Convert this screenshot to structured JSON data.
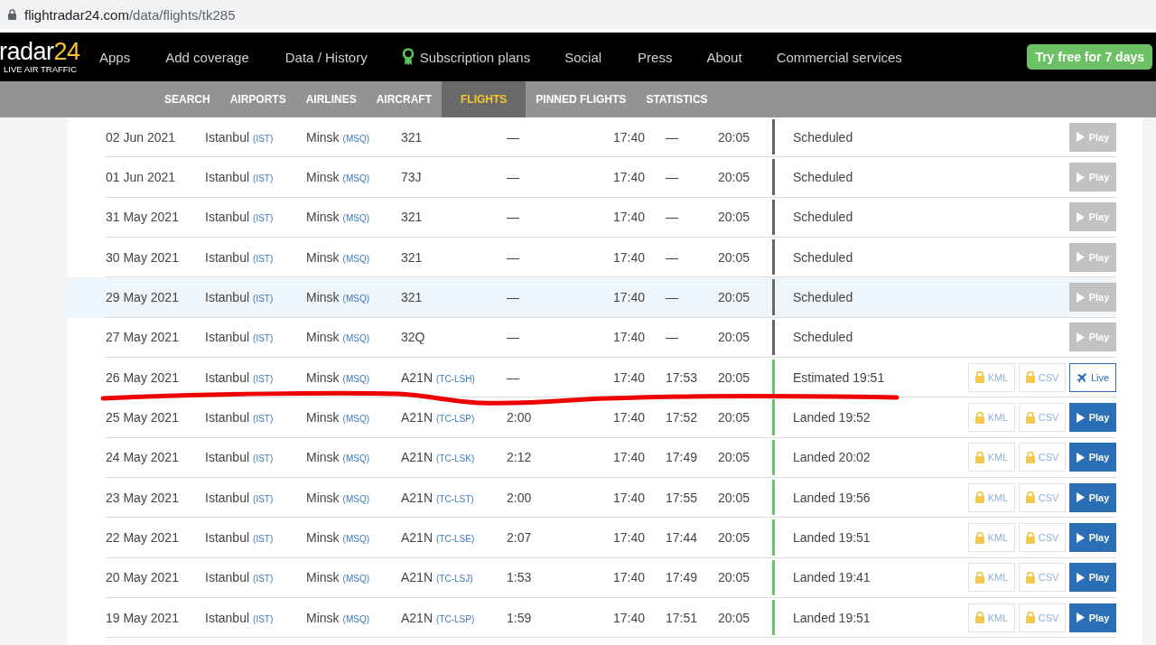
{
  "address_bar": {
    "host": "flightradar24.com",
    "path": "/data/flights/tk285"
  },
  "nav": {
    "logo": {
      "text": "radar",
      "accent": "24",
      "tagline": "LIVE AIR TRAFFIC"
    },
    "items": [
      {
        "label": "Apps",
        "kind": "link"
      },
      {
        "label": "Add coverage",
        "kind": "link"
      },
      {
        "label": "Data / History",
        "kind": "link"
      },
      {
        "label": "Subscription plans",
        "kind": "plans"
      },
      {
        "label": "Social",
        "kind": "link"
      },
      {
        "label": "Press",
        "kind": "link"
      },
      {
        "label": "About",
        "kind": "link"
      },
      {
        "label": "Commercial services",
        "kind": "link"
      }
    ],
    "cta": "Try free for 7 days"
  },
  "subnav": [
    {
      "label": "SEARCH",
      "selected": false
    },
    {
      "label": "AIRPORTS",
      "selected": false
    },
    {
      "label": "AIRLINES",
      "selected": false
    },
    {
      "label": "AIRCRAFT",
      "selected": false
    },
    {
      "label": "FLIGHTS",
      "selected": true
    },
    {
      "label": "PINNED FLIGHTS",
      "selected": false
    },
    {
      "label": "STATISTICS",
      "selected": false
    }
  ],
  "rows": [
    {
      "date": "02 Jun 2021",
      "from": {
        "city": "Istanbul",
        "code": "(IST)"
      },
      "to": {
        "city": "Minsk",
        "code": "(MSQ)"
      },
      "aircraft": {
        "type": "321"
      },
      "duration": "—",
      "std": "17:40",
      "atd": "—",
      "sta": "20:05",
      "status": {
        "kind": "scheduled",
        "text": "Scheduled"
      },
      "action": {
        "kind": "play",
        "label": "Play",
        "disabled": true
      },
      "highlighted": false,
      "underlined": false
    },
    {
      "date": "01 Jun 2021",
      "from": {
        "city": "Istanbul",
        "code": "(IST)"
      },
      "to": {
        "city": "Minsk",
        "code": "(MSQ)"
      },
      "aircraft": {
        "type": "73J"
      },
      "duration": "—",
      "std": "17:40",
      "atd": "—",
      "sta": "20:05",
      "status": {
        "kind": "scheduled",
        "text": "Scheduled"
      },
      "action": {
        "kind": "play",
        "label": "Play",
        "disabled": true
      },
      "highlighted": false,
      "underlined": false
    },
    {
      "date": "31 May 2021",
      "from": {
        "city": "Istanbul",
        "code": "(IST)"
      },
      "to": {
        "city": "Minsk",
        "code": "(MSQ)"
      },
      "aircraft": {
        "type": "321"
      },
      "duration": "—",
      "std": "17:40",
      "atd": "—",
      "sta": "20:05",
      "status": {
        "kind": "scheduled",
        "text": "Scheduled"
      },
      "action": {
        "kind": "play",
        "label": "Play",
        "disabled": true
      },
      "highlighted": false,
      "underlined": false
    },
    {
      "date": "30 May 2021",
      "from": {
        "city": "Istanbul",
        "code": "(IST)"
      },
      "to": {
        "city": "Minsk",
        "code": "(MSQ)"
      },
      "aircraft": {
        "type": "321"
      },
      "duration": "—",
      "std": "17:40",
      "atd": "—",
      "sta": "20:05",
      "status": {
        "kind": "scheduled",
        "text": "Scheduled"
      },
      "action": {
        "kind": "play",
        "label": "Play",
        "disabled": true
      },
      "highlighted": false,
      "underlined": false
    },
    {
      "date": "29 May 2021",
      "from": {
        "city": "Istanbul",
        "code": "(IST)"
      },
      "to": {
        "city": "Minsk",
        "code": "(MSQ)"
      },
      "aircraft": {
        "type": "321"
      },
      "duration": "—",
      "std": "17:40",
      "atd": "—",
      "sta": "20:05",
      "status": {
        "kind": "scheduled",
        "text": "Scheduled"
      },
      "action": {
        "kind": "play",
        "label": "Play",
        "disabled": true
      },
      "highlighted": true,
      "underlined": false
    },
    {
      "date": "27 May 2021",
      "from": {
        "city": "Istanbul",
        "code": "(IST)"
      },
      "to": {
        "city": "Minsk",
        "code": "(MSQ)"
      },
      "aircraft": {
        "type": "32Q"
      },
      "duration": "—",
      "std": "17:40",
      "atd": "—",
      "sta": "20:05",
      "status": {
        "kind": "scheduled",
        "text": "Scheduled"
      },
      "action": {
        "kind": "play",
        "label": "Play",
        "disabled": true
      },
      "highlighted": false,
      "underlined": false
    },
    {
      "date": "26 May 2021",
      "from": {
        "city": "Istanbul",
        "code": "(IST)"
      },
      "to": {
        "city": "Minsk",
        "code": "(MSQ)"
      },
      "aircraft": {
        "type": "A21N",
        "reg": "(TC-LSH)"
      },
      "duration": "—",
      "std": "17:40",
      "atd": "17:53",
      "sta": "20:05",
      "status": {
        "kind": "estimated",
        "text": "Estimated 19:51"
      },
      "downloads": [
        {
          "label": "KML",
          "locked": true
        },
        {
          "label": "CSV",
          "locked": true
        }
      ],
      "action": {
        "kind": "live",
        "label": "Live",
        "disabled": false
      },
      "highlighted": false,
      "underlined": true
    },
    {
      "date": "25 May 2021",
      "from": {
        "city": "Istanbul",
        "code": "(IST)"
      },
      "to": {
        "city": "Minsk",
        "code": "(MSQ)"
      },
      "aircraft": {
        "type": "A21N",
        "reg": "(TC-LSP)"
      },
      "duration": "2:00",
      "std": "17:40",
      "atd": "17:52",
      "sta": "20:05",
      "status": {
        "kind": "landed",
        "text": "Landed 19:52"
      },
      "downloads": [
        {
          "label": "KML",
          "locked": true
        },
        {
          "label": "CSV",
          "locked": true
        }
      ],
      "action": {
        "kind": "play",
        "label": "Play",
        "disabled": false
      },
      "highlighted": false,
      "underlined": false
    },
    {
      "date": "24 May 2021",
      "from": {
        "city": "Istanbul",
        "code": "(IST)"
      },
      "to": {
        "city": "Minsk",
        "code": "(MSQ)"
      },
      "aircraft": {
        "type": "A21N",
        "reg": "(TC-LSK)"
      },
      "duration": "2:12",
      "std": "17:40",
      "atd": "17:49",
      "sta": "20:05",
      "status": {
        "kind": "landed",
        "text": "Landed 20:02"
      },
      "downloads": [
        {
          "label": "KML",
          "locked": true
        },
        {
          "label": "CSV",
          "locked": true
        }
      ],
      "action": {
        "kind": "play",
        "label": "Play",
        "disabled": false
      },
      "highlighted": false,
      "underlined": false
    },
    {
      "date": "23 May 2021",
      "from": {
        "city": "Istanbul",
        "code": "(IST)"
      },
      "to": {
        "city": "Minsk",
        "code": "(MSQ)"
      },
      "aircraft": {
        "type": "A21N",
        "reg": "(TC-LST)"
      },
      "duration": "2:00",
      "std": "17:40",
      "atd": "17:55",
      "sta": "20:05",
      "status": {
        "kind": "landed",
        "text": "Landed 19:56"
      },
      "downloads": [
        {
          "label": "KML",
          "locked": true
        },
        {
          "label": "CSV",
          "locked": true
        }
      ],
      "action": {
        "kind": "play",
        "label": "Play",
        "disabled": false
      },
      "highlighted": false,
      "underlined": false
    },
    {
      "date": "22 May 2021",
      "from": {
        "city": "Istanbul",
        "code": "(IST)"
      },
      "to": {
        "city": "Minsk",
        "code": "(MSQ)"
      },
      "aircraft": {
        "type": "A21N",
        "reg": "(TC-LSE)"
      },
      "duration": "2:07",
      "std": "17:40",
      "atd": "17:44",
      "sta": "20:05",
      "status": {
        "kind": "landed",
        "text": "Landed 19:51"
      },
      "downloads": [
        {
          "label": "KML",
          "locked": true
        },
        {
          "label": "CSV",
          "locked": true
        }
      ],
      "action": {
        "kind": "play",
        "label": "Play",
        "disabled": false
      },
      "highlighted": false,
      "underlined": false
    },
    {
      "date": "20 May 2021",
      "from": {
        "city": "Istanbul",
        "code": "(IST)"
      },
      "to": {
        "city": "Minsk",
        "code": "(MSQ)"
      },
      "aircraft": {
        "type": "A21N",
        "reg": "(TC-LSJ)"
      },
      "duration": "1:53",
      "std": "17:40",
      "atd": "17:49",
      "sta": "20:05",
      "status": {
        "kind": "landed",
        "text": "Landed 19:41"
      },
      "downloads": [
        {
          "label": "KML",
          "locked": true
        },
        {
          "label": "CSV",
          "locked": true
        }
      ],
      "action": {
        "kind": "play",
        "label": "Play",
        "disabled": false
      },
      "highlighted": false,
      "underlined": false
    },
    {
      "date": "19 May 2021",
      "from": {
        "city": "Istanbul",
        "code": "(IST)"
      },
      "to": {
        "city": "Minsk",
        "code": "(MSQ)"
      },
      "aircraft": {
        "type": "A21N",
        "reg": "(TC-LSP)"
      },
      "duration": "1:59",
      "std": "17:40",
      "atd": "17:51",
      "sta": "20:05",
      "status": {
        "kind": "landed",
        "text": "Landed 19:51"
      },
      "downloads": [
        {
          "label": "KML",
          "locked": true
        },
        {
          "label": "CSV",
          "locked": true
        }
      ],
      "action": {
        "kind": "play",
        "label": "Play",
        "disabled": false
      },
      "highlighted": false,
      "underlined": false
    }
  ]
}
